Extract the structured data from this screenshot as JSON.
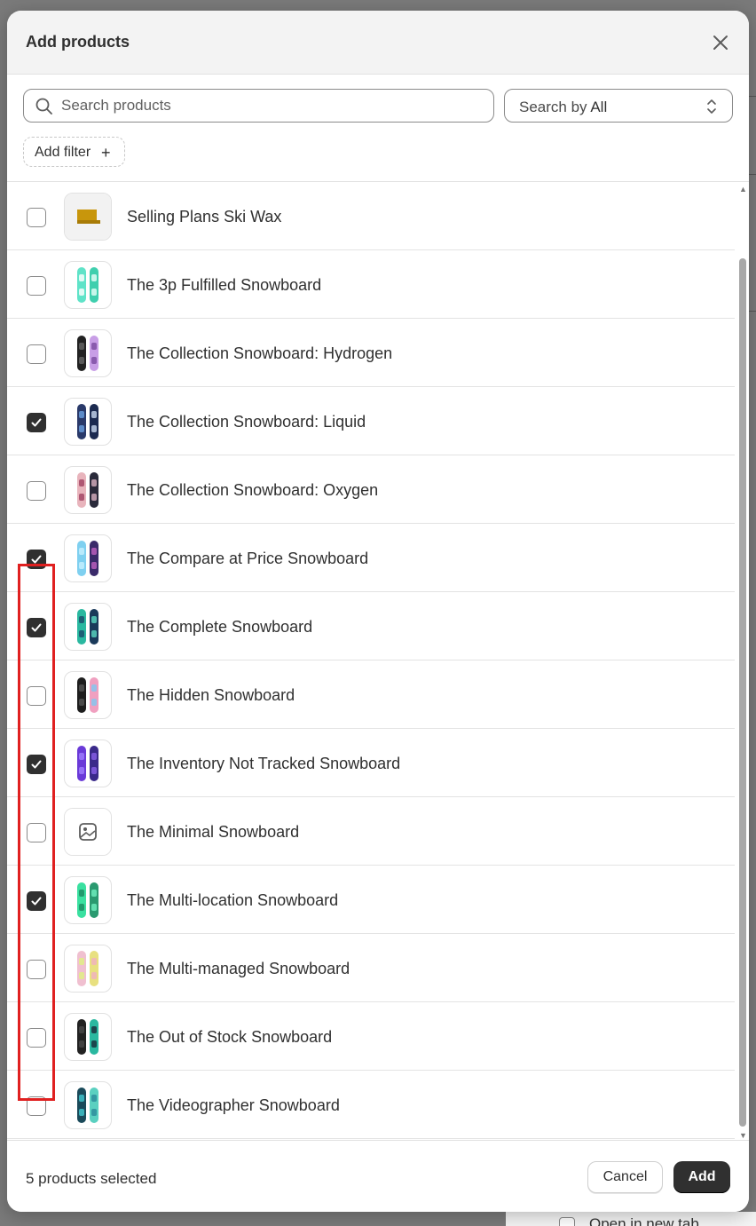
{
  "modal": {
    "title": "Add products",
    "close_icon": "close-icon"
  },
  "search": {
    "placeholder": "Search products",
    "value": "",
    "search_by_label": "Search by ",
    "search_by_value": "All"
  },
  "filter": {
    "add_filter_label": "Add filter",
    "plus_glyph": "+"
  },
  "products": [
    {
      "title": "Selling Plans Ski Wax",
      "checked": false,
      "thumb": "wax"
    },
    {
      "title": "The 3p Fulfilled Snowboard",
      "checked": false,
      "thumb": "teal-dots"
    },
    {
      "title": "The Collection Snowboard: Hydrogen",
      "checked": false,
      "thumb": "black-purple"
    },
    {
      "title": "The Collection Snowboard: Liquid",
      "checked": true,
      "thumb": "navy"
    },
    {
      "title": "The Collection Snowboard: Oxygen",
      "checked": false,
      "thumb": "pink-dark"
    },
    {
      "title": "The Compare at Price Snowboard",
      "checked": true,
      "thumb": "blue-galaxy"
    },
    {
      "title": "The Complete Snowboard",
      "checked": true,
      "thumb": "teal-pattern"
    },
    {
      "title": "The Hidden Snowboard",
      "checked": false,
      "thumb": "black-gradient"
    },
    {
      "title": "The Inventory Not Tracked Snowboard",
      "checked": true,
      "thumb": "purple"
    },
    {
      "title": "The Minimal Snowboard",
      "checked": false,
      "thumb": "placeholder"
    },
    {
      "title": "The Multi-location Snowboard",
      "checked": true,
      "thumb": "green"
    },
    {
      "title": "The Multi-managed Snowboard",
      "checked": false,
      "thumb": "pastel"
    },
    {
      "title": "The Out of Stock Snowboard",
      "checked": false,
      "thumb": "black-teal"
    },
    {
      "title": "The Videographer Snowboard",
      "checked": false,
      "thumb": "teal-dark"
    }
  ],
  "footer": {
    "selected_count": "5 products selected",
    "cancel_label": "Cancel",
    "add_label": "Add"
  },
  "background": {
    "peek_text": "Open in new tab"
  },
  "colors": {
    "primary_button": "#303030",
    "highlight": "#e02020",
    "checkbox_checked": "#303030"
  }
}
